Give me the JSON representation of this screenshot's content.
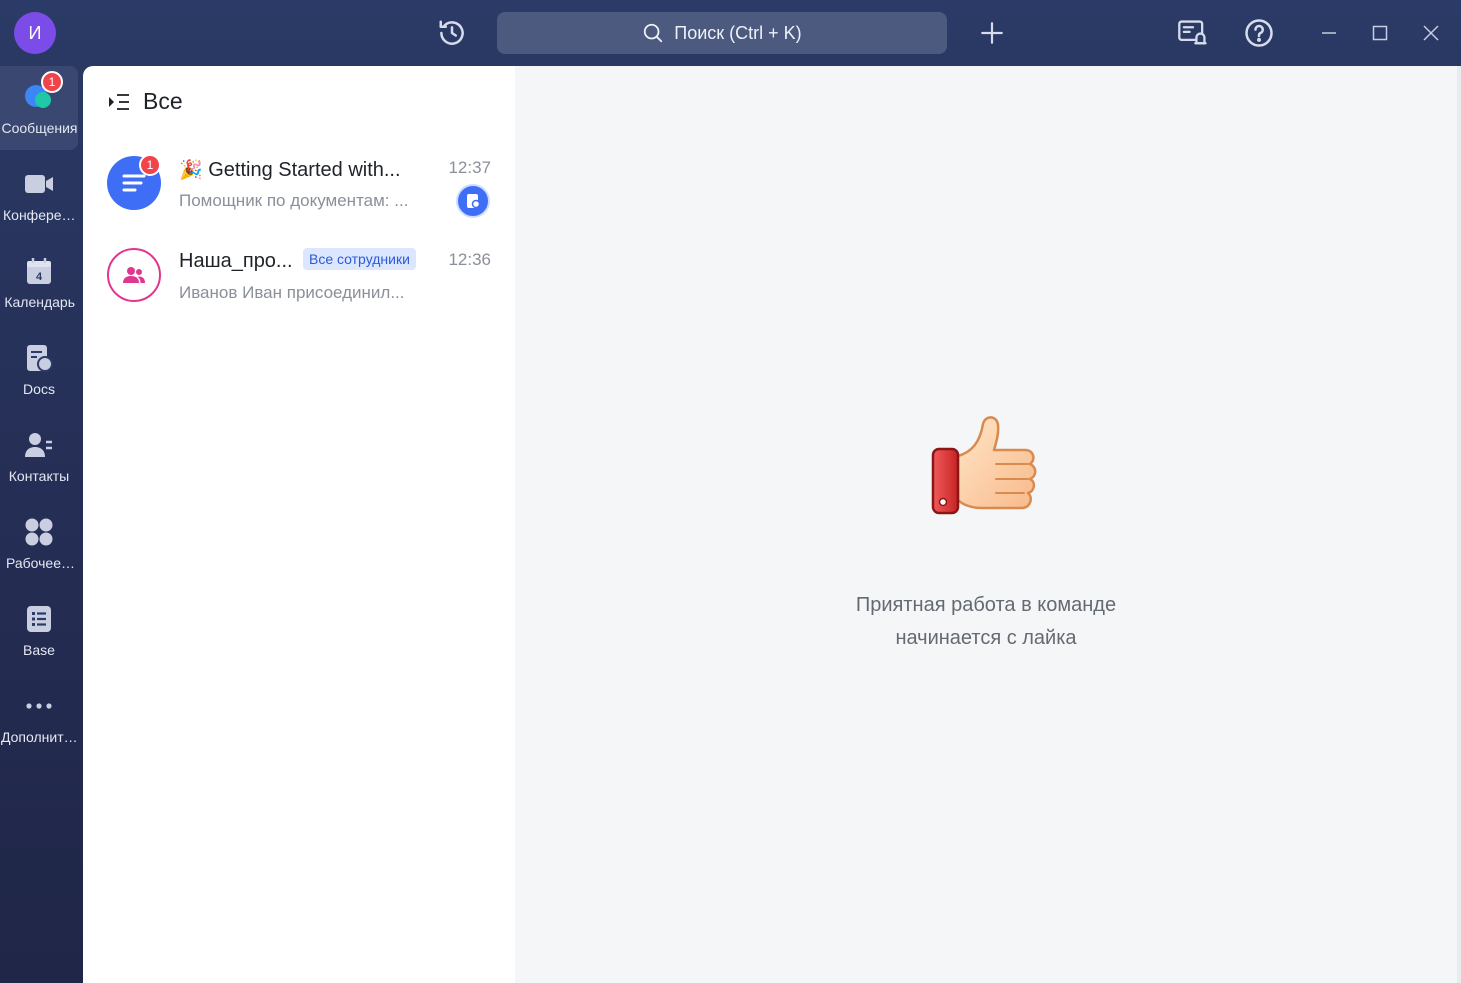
{
  "user": {
    "avatar_letter": "И",
    "avatar_color": "#7c4ce8"
  },
  "titlebar": {
    "history_icon": "history-icon",
    "search_placeholder": "Поиск (Ctrl + K)",
    "add_icon": "plus-icon",
    "notifications_icon": "notification-list-icon",
    "help_icon": "help-icon"
  },
  "nav": {
    "items": [
      {
        "label": "Сообщения",
        "icon": "messages-icon",
        "badge": "1",
        "active": true
      },
      {
        "label": "Конфере…",
        "icon": "video-icon"
      },
      {
        "label": "Календарь",
        "icon": "calendar-icon",
        "icon_text": "4"
      },
      {
        "label": "Docs",
        "icon": "docs-icon"
      },
      {
        "label": "Контакты",
        "icon": "contacts-icon"
      },
      {
        "label": "Рабочее…",
        "icon": "workspace-icon"
      },
      {
        "label": "Base",
        "icon": "base-icon"
      },
      {
        "label": "Дополнит…",
        "icon": "more-icon"
      }
    ]
  },
  "chatlist": {
    "filter_label": "Все",
    "chats": [
      {
        "name": "Getting Started with...",
        "emoji": "🎉",
        "preview": "Помощник по документам: ...",
        "time": "12:37",
        "badge": "1",
        "avatar_color": "#3d6ef5"
      },
      {
        "name": "Наша_про...",
        "tag": "Все сотрудники",
        "preview": "Иванов Иван присоединил...",
        "time": "12:36",
        "avatar_color": "#e0368f"
      }
    ]
  },
  "content": {
    "empty_line1": "Приятная работа в команде",
    "empty_line2": "начинается с лайка"
  }
}
